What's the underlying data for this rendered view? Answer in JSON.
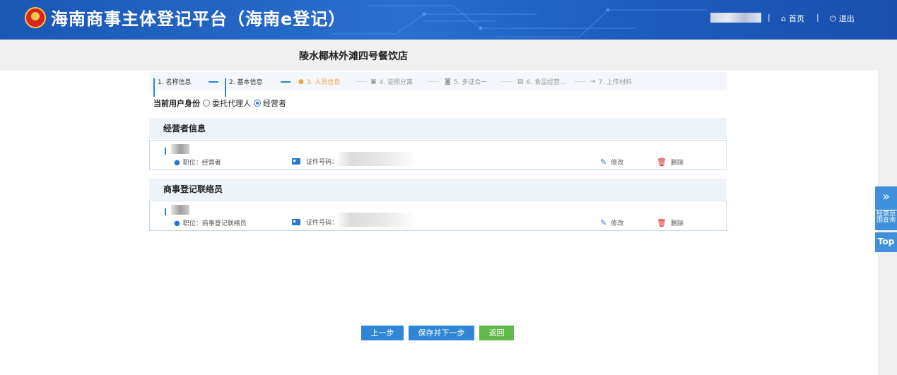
{
  "header": {
    "app_title": "海南商事主体登记平台（海南e登记）",
    "separator": "|",
    "home_label": "首页",
    "logout_label": "退出",
    "home_icon": "home-icon",
    "power_icon": "power-icon"
  },
  "store": {
    "name": "陵水椰林外滩四号餐饮店"
  },
  "steps": [
    {
      "label": "1. 名称信息",
      "status": "done",
      "icon": "bar-chart-icon"
    },
    {
      "label": "2. 基本信息",
      "status": "done",
      "icon": "bar-chart-icon"
    },
    {
      "label": "3. 人员信息",
      "status": "active",
      "icon": "person-icon"
    },
    {
      "label": "4. 证照分离",
      "status": "pending",
      "icon": "license-icon"
    },
    {
      "label": "5. 多证合一",
      "status": "pending",
      "icon": "certificate-icon"
    },
    {
      "label": "6. 食品经营...",
      "status": "pending",
      "icon": "food-license-icon"
    },
    {
      "label": "7. 上传材料",
      "status": "pending",
      "icon": "upload-icon"
    }
  ],
  "identity": {
    "label": "当前用户身份",
    "options": [
      {
        "label": "委托代理人",
        "checked": false
      },
      {
        "label": "经营者",
        "checked": true
      }
    ]
  },
  "sections": [
    {
      "title": "经营者信息",
      "person": {
        "position": "职位：经营者",
        "id_label": "证件号码：",
        "edit_label": "修改",
        "delete_label": "删除"
      }
    },
    {
      "title": "商事登记联络员",
      "person": {
        "position": "职位：商事登记联络员",
        "id_label": "证件号码：",
        "edit_label": "修改",
        "delete_label": "删除"
      }
    }
  ],
  "buttons": {
    "prev": "上一步",
    "save_next": "保存并下一步",
    "back": "返回"
  },
  "float": {
    "expand_icon": "double-chevron-right-icon",
    "scope_query": "经营范围查询",
    "top": "Top"
  },
  "colors": {
    "primary": "#2f86d6",
    "active_step": "#f0a33a",
    "success": "#5fb84a",
    "danger": "#d9282a"
  }
}
